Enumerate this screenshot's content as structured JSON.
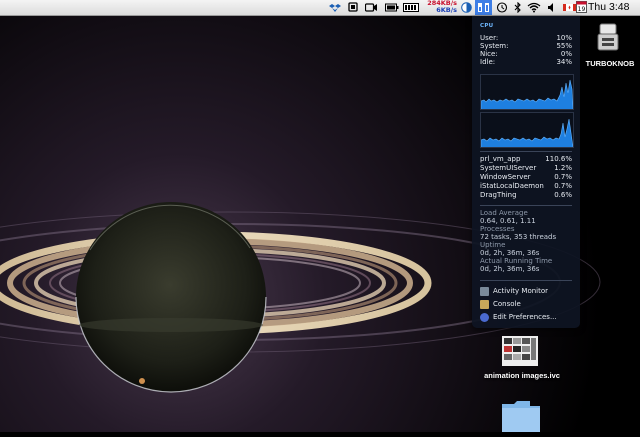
{
  "menubar": {
    "net_up": "284KB/s",
    "net_down": "6KB/s",
    "clock": "Thu 3:48",
    "calendar_day": "19",
    "icons": [
      "dropbox-icon",
      "display-icon",
      "video-icon",
      "battery-icon",
      "cpu-meter-icon",
      "network-speed",
      "pie-icon",
      "istat-icon",
      "time-machine-icon",
      "bluetooth-icon",
      "wifi-icon",
      "volume-icon",
      "flag-icon",
      "calendar-icon"
    ]
  },
  "istat": {
    "section": "CPU",
    "stats": [
      {
        "label": "User:",
        "value": "10%"
      },
      {
        "label": "System:",
        "value": "55%"
      },
      {
        "label": "Nice:",
        "value": "0%"
      },
      {
        "label": "Idle:",
        "value": "34%"
      }
    ],
    "processes": [
      {
        "name": "prl_vm_app",
        "value": "110.6%"
      },
      {
        "name": "SystemUIServer",
        "value": "1.2%"
      },
      {
        "name": "WindowServer",
        "value": "0.7%"
      },
      {
        "name": "iStatLocalDaemon",
        "value": "0.7%"
      },
      {
        "name": "DragThing",
        "value": "0.6%"
      }
    ],
    "load_average_title": "Load Average",
    "load_average": "0.64, 0.61, 1.11",
    "processes_title": "Processes",
    "processes_count": "72 tasks, 353 threads",
    "uptime_title": "Uptime",
    "uptime": "0d, 2h, 36m, 36s",
    "running_title": "Actual Running Time",
    "running": "0d, 2h, 36m, 36s",
    "menu": [
      {
        "label": "Activity Monitor",
        "icon": "activity-monitor-icon",
        "color": "#7a8a9a"
      },
      {
        "label": "Console",
        "icon": "console-icon",
        "color": "#c9a85a"
      },
      {
        "label": "Edit Preferences...",
        "icon": "preferences-icon",
        "color": "#4a6ad0"
      }
    ]
  },
  "desktop": {
    "turboknob_label": "TURBOKNOB",
    "animation_label": "animation images.ivc"
  }
}
